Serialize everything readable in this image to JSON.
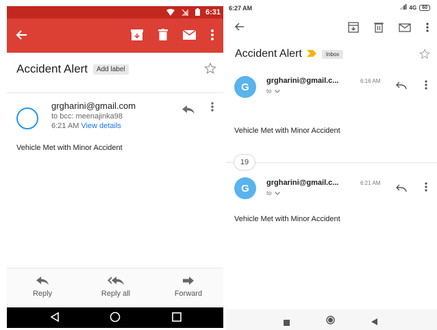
{
  "left": {
    "status_time": "6:31",
    "subject": "Accident Alert",
    "add_label": "Add label",
    "sender_email": "grgharini@gmail.com",
    "recipients": "to bcc: meenajinka98",
    "received_time": "6:21 AM",
    "view_details": "View details",
    "body_text": "Vehicle Met with Minor Accident",
    "actions": [
      {
        "label": "Reply",
        "icon": "reply-icon"
      },
      {
        "label": "Reply all",
        "icon": "reply-all-icon"
      },
      {
        "label": "Forward",
        "icon": "forward-icon"
      }
    ],
    "nav_icons": [
      "back-triangle-icon",
      "home-circle-icon",
      "recents-square-icon"
    ],
    "colors": {
      "status_bar": "#c2281f",
      "toolbar": "#dc3f34",
      "avatar_ring": "#2196f3",
      "link": "#1a73e8"
    }
  },
  "right": {
    "status_time": "6:27 AM",
    "network": "4G",
    "battery": "60",
    "subject": "Accident Alert",
    "folder_chip": "Inbox",
    "messages": [
      {
        "avatar_letter": "G",
        "sender": "grgharini@gmail.c...",
        "time": "6:16 AM",
        "to": "to",
        "body": "Vehicle Met with Minor Accident"
      },
      {
        "avatar_letter": "G",
        "sender": "grgharini@gmail.c...",
        "time": "6:21 AM",
        "to": "to",
        "body": "Vehicle Met with Minor Accident"
      }
    ],
    "date_separator": "19",
    "colors": {
      "avatar": "#59b3ec",
      "importance_marker": "#f4b400"
    }
  }
}
